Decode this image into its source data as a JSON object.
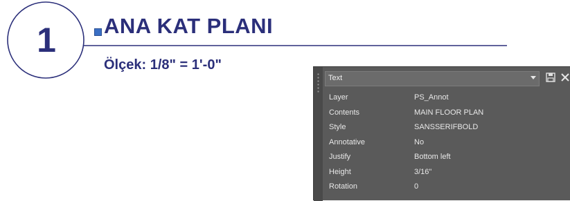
{
  "view_label": {
    "number": "1",
    "title": "ANA KAT PLANI",
    "scale": "Ölçek: 1/8\" = 1'-0\""
  },
  "properties_palette": {
    "object_type": "Text",
    "rows": [
      {
        "name": "Layer",
        "value": "PS_Annot"
      },
      {
        "name": "Contents",
        "value": "MAIN FLOOR PLAN"
      },
      {
        "name": "Style",
        "value": "SANSSERIFBOLD"
      },
      {
        "name": "Annotative",
        "value": "No"
      },
      {
        "name": "Justify",
        "value": "Bottom left"
      },
      {
        "name": "Height",
        "value": "3/16\""
      },
      {
        "name": "Rotation",
        "value": "0"
      }
    ]
  },
  "colors": {
    "annotation": "#2b2f7a",
    "grip": "#3a6fc4",
    "palette_bg": "#5a5a5a",
    "palette_text": "#e8e8e8"
  },
  "icons": [
    "grip-handle",
    "chevron-down-icon",
    "save-icon",
    "close-icon"
  ]
}
